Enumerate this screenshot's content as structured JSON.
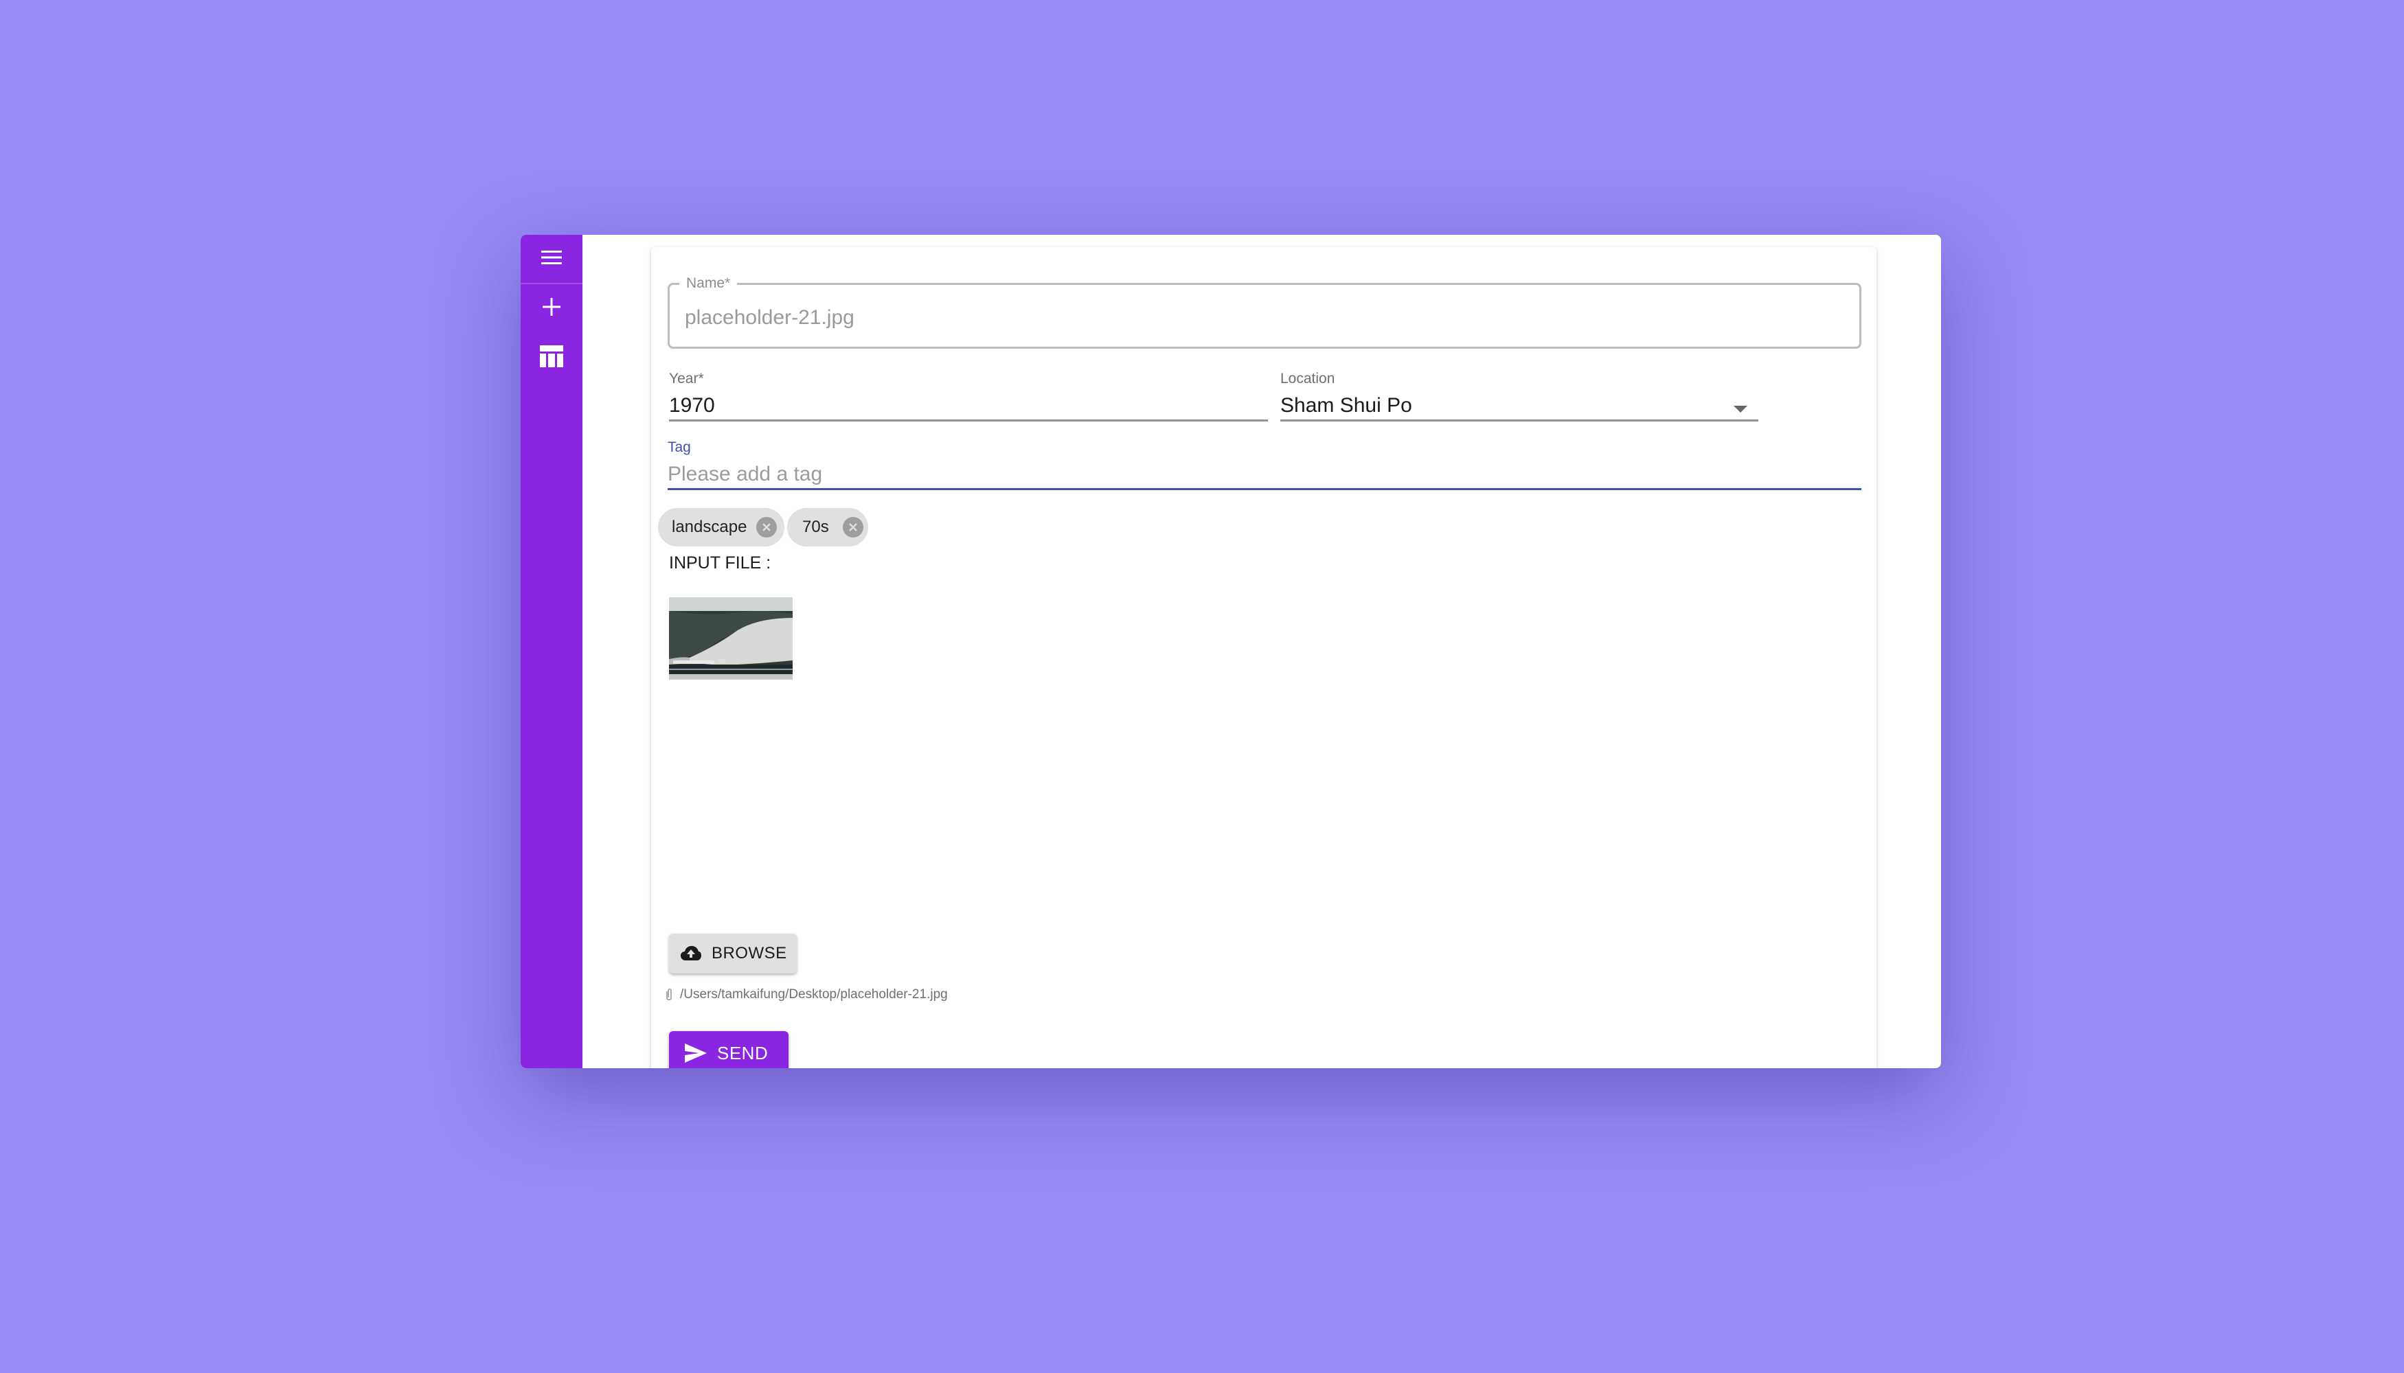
{
  "sidebar": {
    "icons": [
      "menu-icon",
      "add-icon",
      "table-icon"
    ]
  },
  "form": {
    "name": {
      "label": "Name",
      "required_mark": "*",
      "value": "placeholder-21.jpg"
    },
    "year": {
      "label": "Year",
      "required_mark": "*",
      "value": "1970"
    },
    "location": {
      "label": "Location",
      "value": "Sham Shui Po"
    },
    "tag": {
      "label": "Tag",
      "placeholder": "Please add a tag",
      "chips": [
        {
          "label": "landscape"
        },
        {
          "label": "70s"
        }
      ]
    },
    "input_file_label": "INPUT FILE :",
    "browse_label": "BROWSE",
    "file_path": "/Users/tamkaifung/Desktop/placeholder-21.jpg",
    "send_label": "SEND"
  },
  "colors": {
    "background": "#978bf6",
    "sidebar": "#8a26e2",
    "accent_underline": "#3f51b5",
    "send_button": "#8a26e2"
  }
}
